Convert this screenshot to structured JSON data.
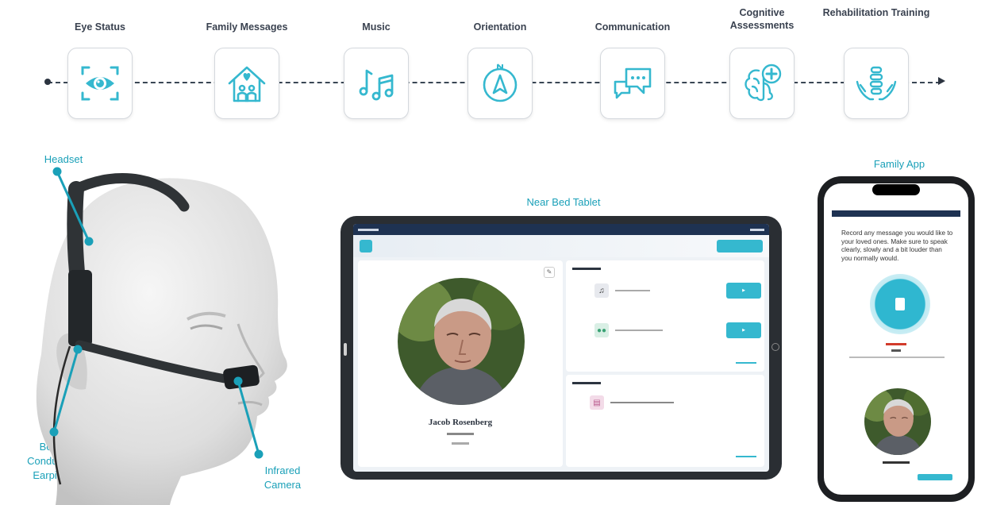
{
  "features": [
    {
      "label": "Eye Status",
      "icon": "eye-scan-icon"
    },
    {
      "label": "Family Messages",
      "icon": "family-house-icon"
    },
    {
      "label": "Music",
      "icon": "music-notes-icon"
    },
    {
      "label": "Orientation",
      "icon": "compass-icon"
    },
    {
      "label": "Communication",
      "icon": "chat-bubbles-icon"
    },
    {
      "label": "Cognitive Assessments",
      "icon": "brain-plus-icon"
    },
    {
      "label": "Rehabilitation Training",
      "icon": "spine-hands-icon"
    }
  ],
  "callouts": {
    "headset": "Headset",
    "bone": "Bone-Conduction Earpiece",
    "camera": "Infrared Camera",
    "tablet": "Near Bed Tablet",
    "phone": "Family App"
  },
  "tablet": {
    "patient_name": "Jacob Rosenberg"
  },
  "phone": {
    "instruction": "Record any message you would like to your loved ones. Make sure to speak clearly, slowly and a bit louder than you normally would."
  },
  "colors": {
    "accent": "#1aa0b8",
    "icon": "#35b8cf",
    "navy": "#1e3252"
  }
}
